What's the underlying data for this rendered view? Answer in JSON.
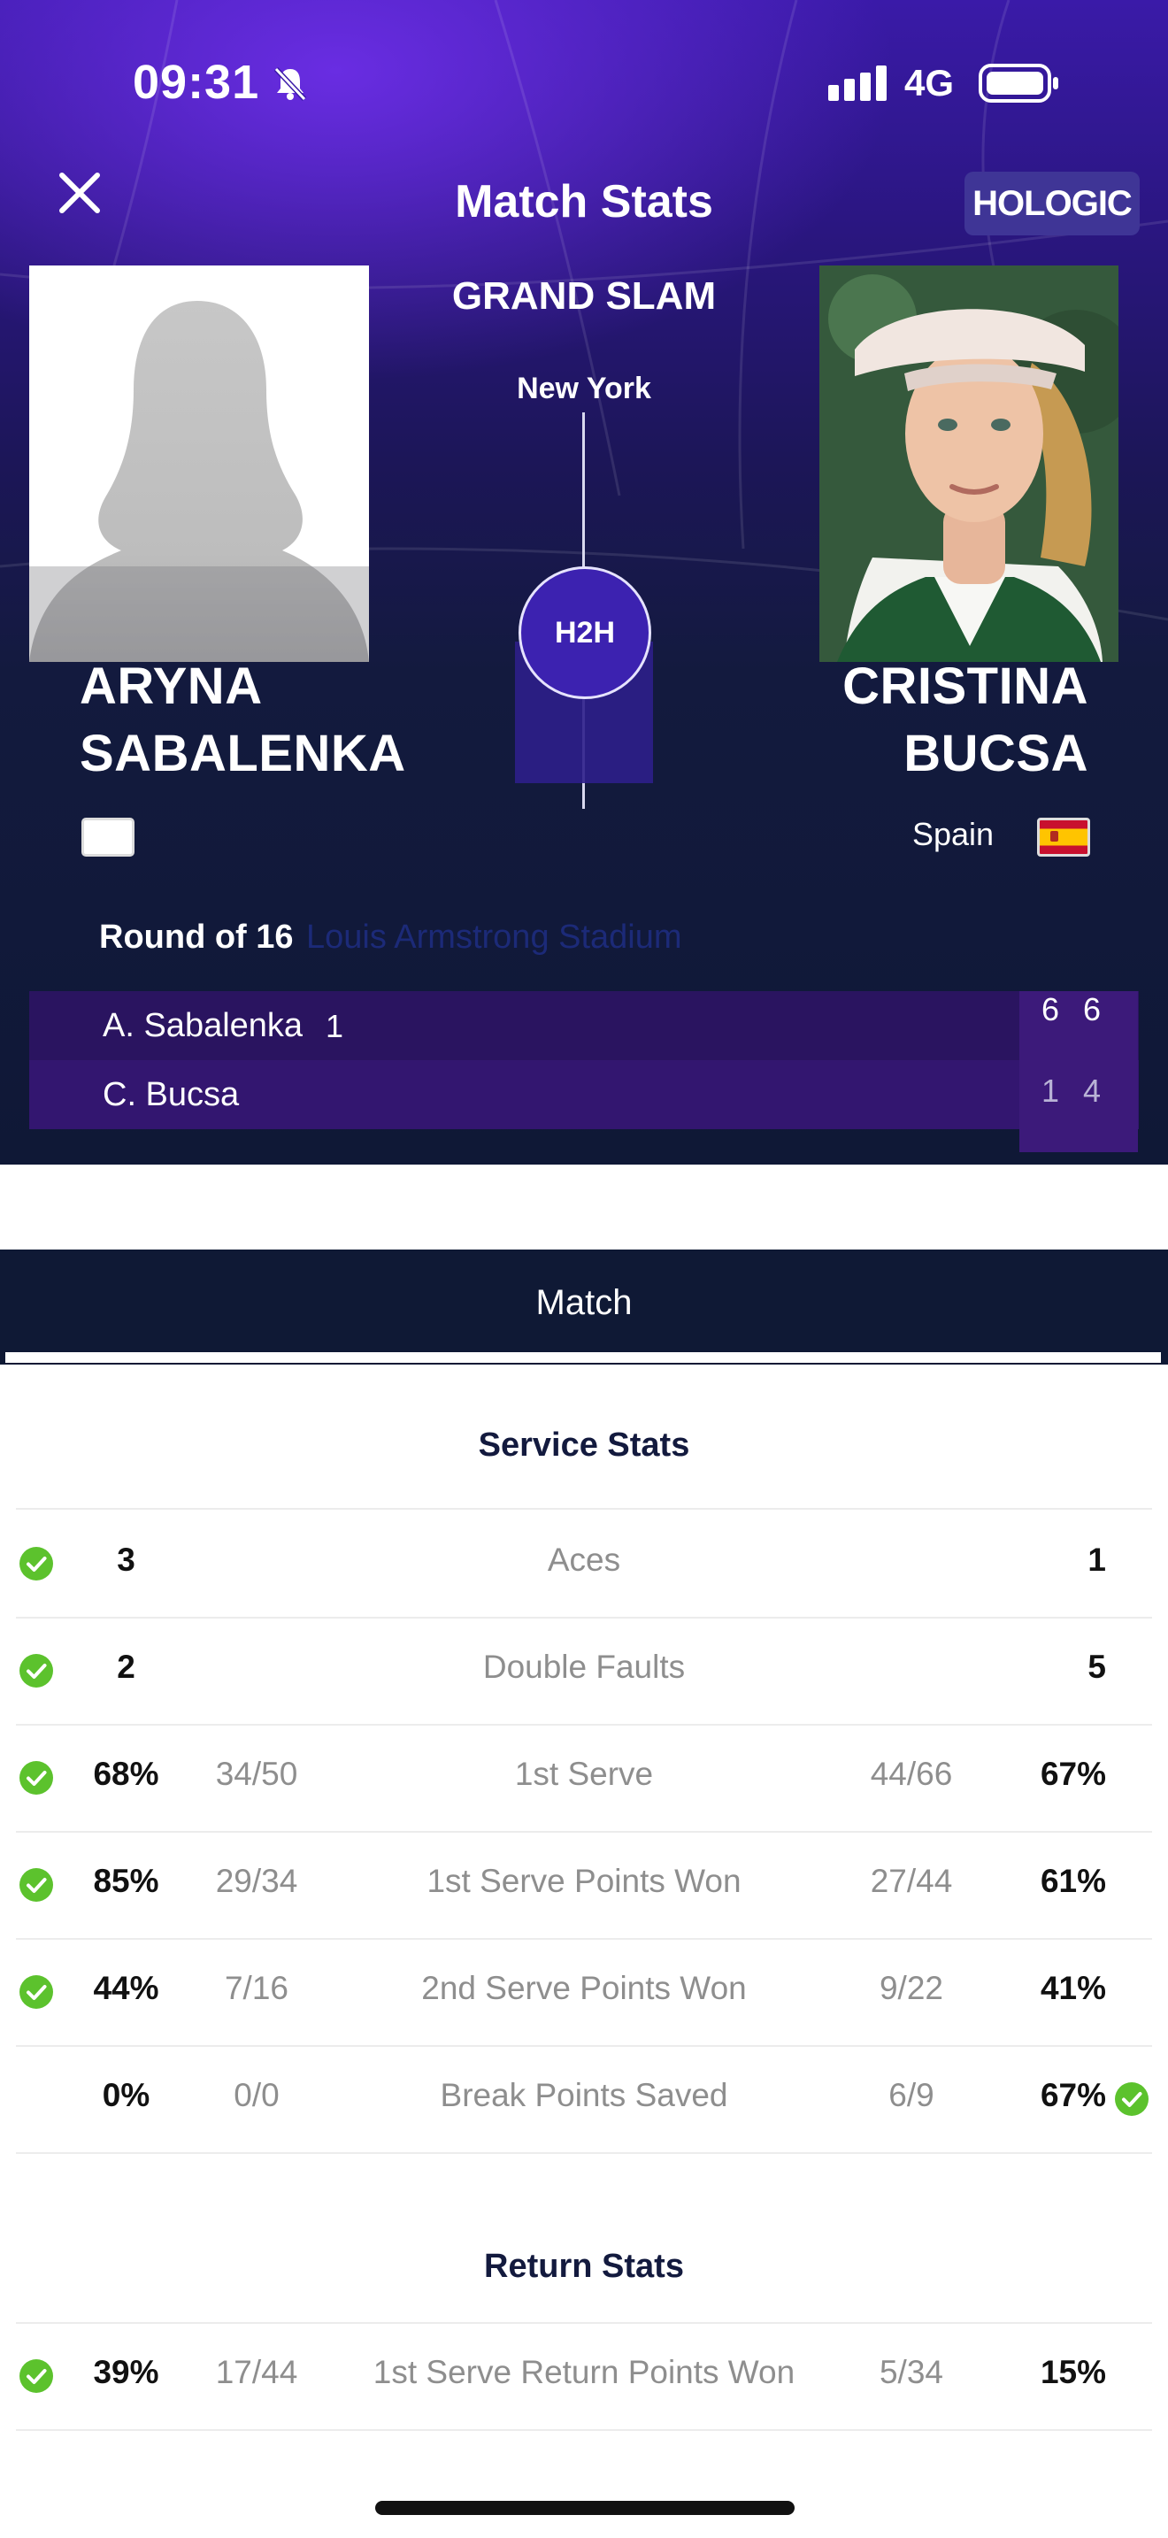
{
  "status_bar": {
    "time": "09:31",
    "network": "4G",
    "icons": [
      "bell-muted-icon",
      "signal-icon",
      "battery-icon"
    ]
  },
  "header": {
    "title": "Match Stats",
    "sponsor": "HOLOGIC",
    "close_icon": "close-icon",
    "tournament": "GRAND SLAM",
    "city": "New York",
    "h2h_label": "H2H"
  },
  "players": {
    "left": {
      "name_line1": "ARYNA",
      "name_line2": "SABALENKA",
      "photo": "silhouette-placeholder",
      "flag": "blank-flag"
    },
    "right": {
      "name_line1": "CRISTINA",
      "name_line2": "BUCSA",
      "country": "Spain",
      "photo": "player-headshot",
      "flag": "spain-flag"
    }
  },
  "match": {
    "round": "Round of 16",
    "venue": "Louis Armstrong Stadium",
    "scores": [
      {
        "name": "A. Sabalenka",
        "serve_marker": "1",
        "sets": [
          "6",
          "6"
        ]
      },
      {
        "name": "C. Bucsa",
        "sets": [
          "1",
          "4"
        ]
      }
    ]
  },
  "tabs": {
    "active": "Match"
  },
  "service_stats": {
    "title": "Service Stats",
    "rows": [
      {
        "label": "Aces",
        "p1": "3",
        "p1_frac": "",
        "p2_frac": "",
        "p2": "1",
        "leader": "left"
      },
      {
        "label": "Double Faults",
        "p1": "2",
        "p1_frac": "",
        "p2_frac": "",
        "p2": "5",
        "leader": "left"
      },
      {
        "label": "1st Serve",
        "p1": "68%",
        "p1_frac": "34/50",
        "p2_frac": "44/66",
        "p2": "67%",
        "leader": "left"
      },
      {
        "label": "1st Serve Points Won",
        "p1": "85%",
        "p1_frac": "29/34",
        "p2_frac": "27/44",
        "p2": "61%",
        "leader": "left"
      },
      {
        "label": "2nd Serve Points Won",
        "p1": "44%",
        "p1_frac": "7/16",
        "p2_frac": "9/22",
        "p2": "41%",
        "leader": "left"
      },
      {
        "label": "Break Points Saved",
        "p1": "0%",
        "p1_frac": "0/0",
        "p2_frac": "6/9",
        "p2": "67%",
        "leader": "right"
      }
    ]
  },
  "return_stats": {
    "title": "Return Stats",
    "rows": [
      {
        "label": "1st Serve Return Points Won",
        "p1": "39%",
        "p1_frac": "17/44",
        "p2_frac": "5/34",
        "p2": "15%",
        "leader": "left"
      }
    ]
  },
  "colors": {
    "hero_top": "#3a1aa8",
    "hero_bottom": "#0f1836",
    "score_row": "#2a1460",
    "check_green": "#5cc22d",
    "tab_bar": "#0f1935"
  }
}
